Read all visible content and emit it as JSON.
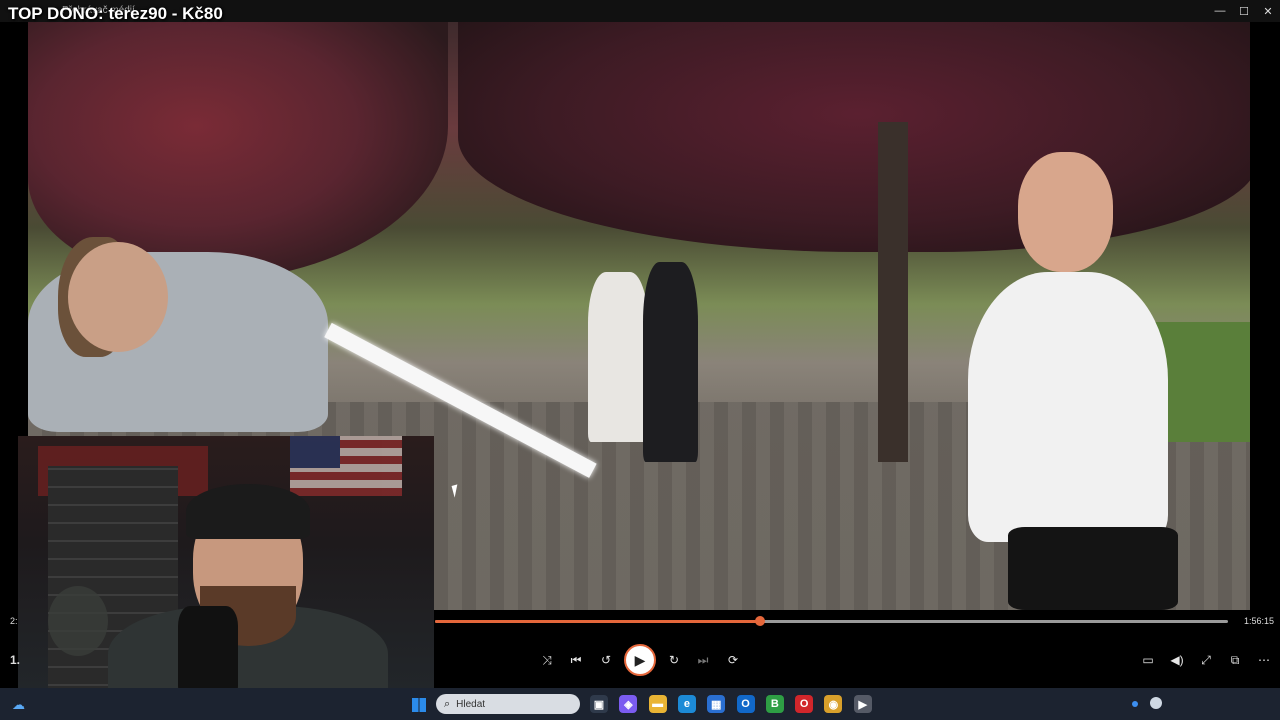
{
  "window": {
    "app_title": "Přehrávač médií",
    "minimize_icon": "minimize-icon",
    "maximize_icon": "maximize-icon",
    "close_icon": "close-icon"
  },
  "overlay": {
    "top_dono": "TOP DONO: terez90 - Kč80"
  },
  "player": {
    "time_left": "2:",
    "time_right": "1:56:15",
    "left_label": "1.",
    "progress_fraction": 0.41,
    "accent": "#e5673b",
    "controls": [
      {
        "name": "shuffle-icon",
        "glyph": "⤨"
      },
      {
        "name": "previous-icon",
        "glyph": "⏮"
      },
      {
        "name": "rewind-10-icon",
        "glyph": "↺"
      },
      {
        "name": "forward-30-icon",
        "glyph": "↻"
      },
      {
        "name": "next-icon",
        "glyph": "⏭"
      },
      {
        "name": "repeat-off-icon",
        "glyph": "⟳"
      }
    ],
    "right_controls": [
      {
        "name": "subtitles-icon",
        "glyph": "▭"
      },
      {
        "name": "volume-icon",
        "glyph": "🔊"
      },
      {
        "name": "fullscreen-icon",
        "glyph": "⤢"
      },
      {
        "name": "miniplayer-icon",
        "glyph": "⧉"
      },
      {
        "name": "more-options-icon",
        "glyph": "⋯"
      }
    ]
  },
  "taskbar": {
    "search_placeholder": "Hledat",
    "apps": [
      {
        "name": "task-view-icon",
        "glyph": "▣",
        "color": "#2f3a4b"
      },
      {
        "name": "copilot-icon",
        "glyph": "◈",
        "color": "#7b5cf0"
      },
      {
        "name": "file-explorer-icon",
        "glyph": "▬",
        "color": "#e9b434"
      },
      {
        "name": "edge-icon",
        "glyph": "e",
        "color": "#1c8ad6"
      },
      {
        "name": "store-icon",
        "glyph": "▦",
        "color": "#2a6fd1"
      },
      {
        "name": "outlook-icon",
        "glyph": "O",
        "color": "#1168c9"
      },
      {
        "name": "b-app-icon",
        "glyph": "B",
        "color": "#2e9e44"
      },
      {
        "name": "opera-icon",
        "glyph": "O",
        "color": "#d1262b"
      },
      {
        "name": "game-app-icon",
        "glyph": "◉",
        "color": "#d9a02b"
      },
      {
        "name": "media-player-icon",
        "glyph": "▶",
        "color": "#555a66"
      }
    ]
  }
}
